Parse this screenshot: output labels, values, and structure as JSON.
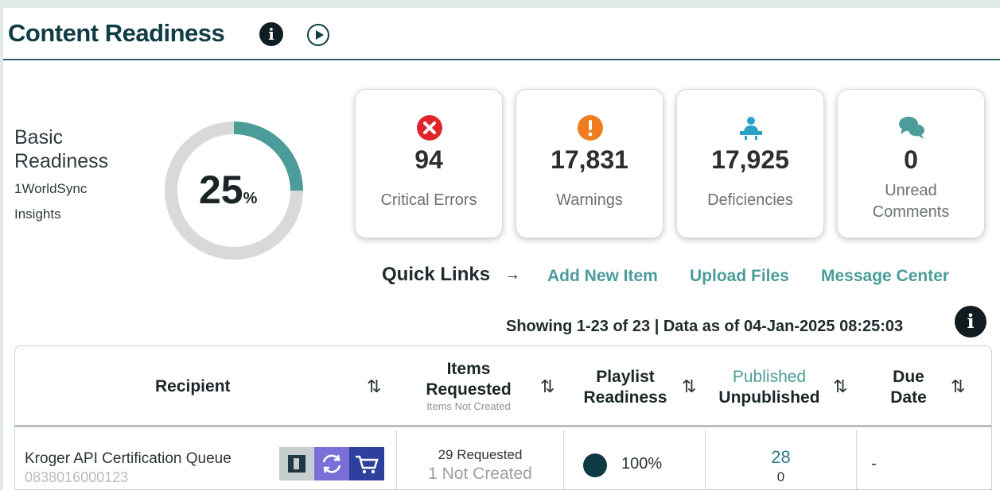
{
  "header": {
    "title": "Content Readiness",
    "info_icon": "info-icon",
    "play_icon": "play-icon"
  },
  "readiness": {
    "title": "Basic Readiness",
    "subtitle": "1WorldSync Insights",
    "value": "25",
    "unit": "%",
    "fraction": 0.25,
    "color_fill": "#4c9c9a",
    "color_track": "#d9d9d9"
  },
  "cards": [
    {
      "icon": "x-circle-icon",
      "value": "94",
      "label": "Critical Errors",
      "color": "#e0242e"
    },
    {
      "icon": "exclamation-circle-icon",
      "value": "17,831",
      "label": "Warnings",
      "color": "#f07c1e"
    },
    {
      "icon": "presenter-icon",
      "value": "17,925",
      "label": "Deficiencies",
      "color": "#2aa3c6"
    },
    {
      "icon": "chat-bubbles-icon",
      "value": "0",
      "label": "Unread Comments",
      "color": "#4c9c9a"
    }
  ],
  "quick_links": {
    "label": "Quick Links",
    "arrow": "→",
    "links": [
      "Add New Item",
      "Upload Files",
      "Message Center"
    ]
  },
  "status": {
    "showing": "Showing 1-23 of 23 | Data as of 04-Jan-2025 08:25:03"
  },
  "table": {
    "columns": {
      "recipient": "Recipient",
      "items_requested_1": "Items",
      "items_requested_2": "Requested",
      "items_sub": "Items Not Created",
      "playlist_1": "Playlist",
      "playlist_2": "Readiness",
      "published": "Published",
      "unpublished": "Unpublished",
      "due_1": "Due",
      "due_2": "Date",
      "sort_glyph": "⇅"
    },
    "rows": [
      {
        "recipient": "Kroger API Certification Queue",
        "gln": "0838016000123",
        "requested": "29 Requested",
        "not_created": "1 Not Created",
        "readiness": "100%",
        "published": "28",
        "unpublished": "0",
        "due": "-"
      }
    ]
  }
}
